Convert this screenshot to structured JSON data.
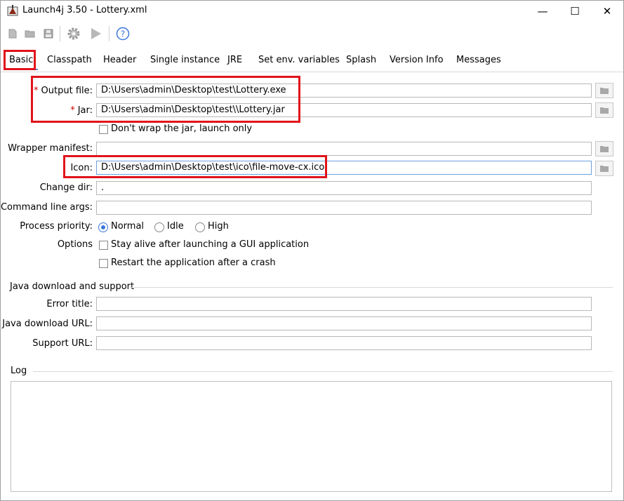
{
  "window": {
    "title": "Launch4j 3.50 - Lottery.xml",
    "controls": {
      "minimize": "—",
      "maximize": "☐",
      "close": "✕"
    }
  },
  "toolbar": {
    "icons": [
      "new-file-icon",
      "open-folder-icon",
      "save-icon",
      "build-gear-icon",
      "run-icon",
      "help-icon"
    ]
  },
  "tabs": [
    "Basic",
    "Classpath",
    "Header",
    "Single instance",
    "JRE",
    "Set env. variables",
    "Splash",
    "Version Info",
    "Messages"
  ],
  "active_tab": "Basic",
  "basic": {
    "output_file": {
      "required_mark": "*",
      "label": "Output file:",
      "value": "D:\\Users\\admin\\Desktop\\test\\Lottery.exe"
    },
    "jar": {
      "required_mark": "*",
      "label": "Jar:",
      "value": "D:\\Users\\admin\\Desktop\\test\\\\Lottery.jar"
    },
    "dont_wrap": {
      "label": "Don't wrap the jar, launch only",
      "checked": false
    },
    "wrapper_manifest": {
      "label": "Wrapper manifest:",
      "value": ""
    },
    "icon": {
      "label": "Icon:",
      "value": "D:\\Users\\admin\\Desktop\\test\\ico\\file-move-cx.ico"
    },
    "change_dir": {
      "label": "Change dir:",
      "value": "."
    },
    "command_line_args": {
      "label": "Command line args:",
      "value": ""
    },
    "process_priority": {
      "label": "Process priority:",
      "options": [
        "Normal",
        "Idle",
        "High"
      ],
      "selected": "Normal"
    },
    "options": {
      "label": "Options",
      "stay_alive": {
        "label": "Stay alive after launching a GUI application",
        "checked": false
      },
      "restart": {
        "label": "Restart the application after a crash",
        "checked": false
      }
    }
  },
  "java_download": {
    "title": "Java download and support",
    "error_title": {
      "label": "Error title:",
      "value": ""
    },
    "download_url": {
      "label": "Java download URL:",
      "value": ""
    },
    "support_url": {
      "label": "Support URL:",
      "value": ""
    }
  },
  "log": {
    "title": "Log",
    "content": ""
  },
  "colors": {
    "highlight": "#e0131b",
    "accent": "#3b78d8",
    "required": "#d00000"
  }
}
